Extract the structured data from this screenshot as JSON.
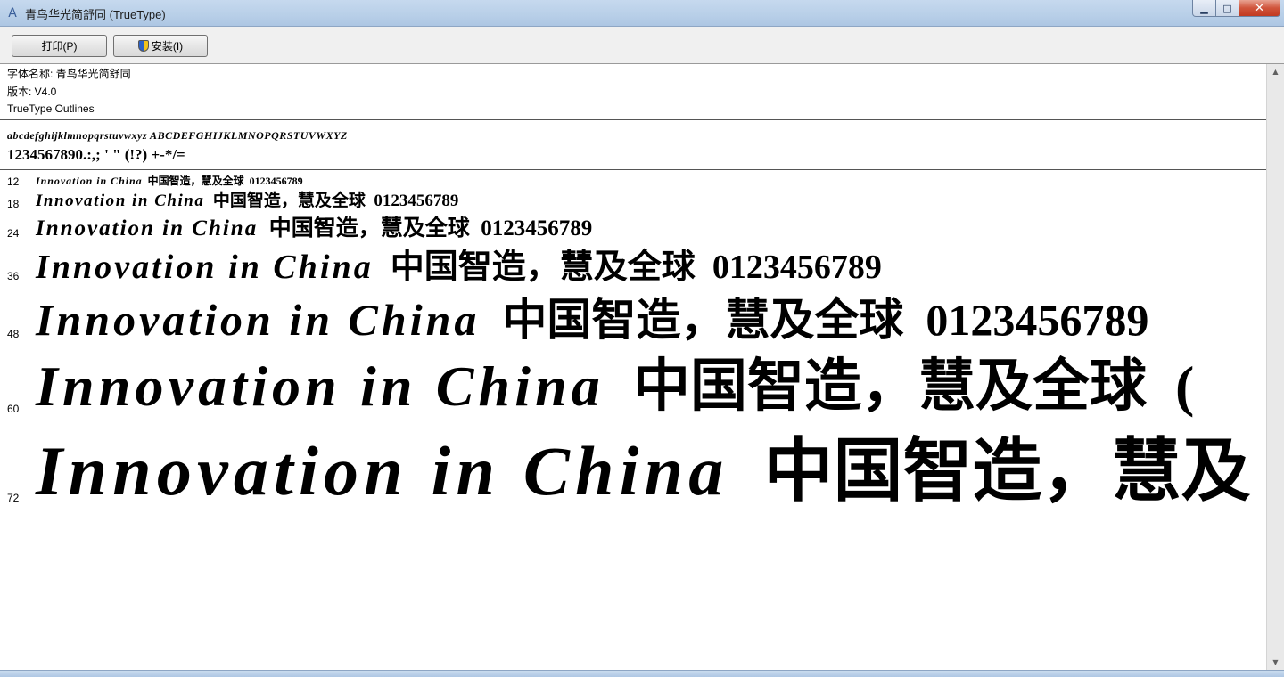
{
  "window": {
    "title": "青鸟华光简舒同 (TrueType)",
    "app_icon": "font-viewer-icon",
    "min_glyph": "▁",
    "max_glyph": "□",
    "close_glyph": "✕"
  },
  "toolbar": {
    "print_label": "打印(P)",
    "install_label": "安装(I)"
  },
  "font_info": {
    "name_line": "字体名称: 青鸟华光简舒同",
    "version_line": "版本: V4.0",
    "outline_line": "TrueType Outlines"
  },
  "charset": {
    "letters": "abcdefghijklmnopqrstuvwxyz  ABCDEFGHIJKLMNOPQRSTUVWXYZ",
    "digits": "1234567890.:,; ' \" (!?) +-*/="
  },
  "samples": [
    {
      "size": "12",
      "latin": "Innovation  in  China",
      "cjk": "中国智造，慧及全球",
      "digits": "0123456789"
    },
    {
      "size": "18",
      "latin": "Innovation  in  China",
      "cjk": "中国智造，慧及全球",
      "digits": "0123456789"
    },
    {
      "size": "24",
      "latin": "Innovation  in  China",
      "cjk": "中国智造，慧及全球",
      "digits": "0123456789"
    },
    {
      "size": "36",
      "latin": "Innovation  in  China",
      "cjk": "中国智造，慧及全球",
      "digits": "0123456789"
    },
    {
      "size": "48",
      "latin": "Innovation  in  China",
      "cjk": "中国智造，慧及全球",
      "digits": "0123456789"
    },
    {
      "size": "60",
      "latin": "Innovation  in  China",
      "cjk": "中国智造，慧及全球",
      "digits": "("
    },
    {
      "size": "72",
      "latin": "Innovation  in  China",
      "cjk": "中国智造，慧及",
      "digits": ""
    }
  ],
  "scroll": {
    "up_glyph": "▲",
    "down_glyph": "▼"
  }
}
